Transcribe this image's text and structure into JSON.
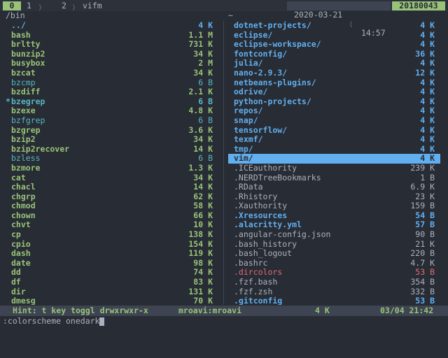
{
  "topbar": {
    "tabs": [
      "0",
      "1",
      "2"
    ],
    "tab2_title": "vifm",
    "date": "2020-03-21",
    "time": "14:57",
    "build": "20180043"
  },
  "left_pane": {
    "path": "/bin",
    "rows": [
      {
        "name": "../",
        "size": "4 K",
        "type": "dir"
      },
      {
        "name": "bash",
        "size": "1.1 M",
        "type": "exe"
      },
      {
        "name": "brltty",
        "size": "731 K",
        "type": "exe"
      },
      {
        "name": "bunzip2",
        "size": "34 K",
        "type": "exe"
      },
      {
        "name": "busybox",
        "size": "2 M",
        "type": "exe"
      },
      {
        "name": "bzcat",
        "size": "34 K",
        "type": "exe"
      },
      {
        "name": "bzcmp",
        "size": "6 B",
        "type": "link"
      },
      {
        "name": "bzdiff",
        "size": "2.1 K",
        "type": "exe"
      },
      {
        "name": "bzegrep",
        "size": "6 B",
        "type": "curlink",
        "marker": "*"
      },
      {
        "name": "bzexe",
        "size": "4.8 K",
        "type": "exe"
      },
      {
        "name": "bzfgrep",
        "size": "6 B",
        "type": "link"
      },
      {
        "name": "bzgrep",
        "size": "3.6 K",
        "type": "exe"
      },
      {
        "name": "bzip2",
        "size": "34 K",
        "type": "exe"
      },
      {
        "name": "bzip2recover",
        "size": "14 K",
        "type": "exe"
      },
      {
        "name": "bzless",
        "size": "6 B",
        "type": "link"
      },
      {
        "name": "bzmore",
        "size": "1.3 K",
        "type": "exe"
      },
      {
        "name": "cat",
        "size": "34 K",
        "type": "exe"
      },
      {
        "name": "chacl",
        "size": "14 K",
        "type": "exe"
      },
      {
        "name": "chgrp",
        "size": "62 K",
        "type": "exe"
      },
      {
        "name": "chmod",
        "size": "58 K",
        "type": "exe"
      },
      {
        "name": "chown",
        "size": "66 K",
        "type": "exe"
      },
      {
        "name": "chvt",
        "size": "10 K",
        "type": "exe"
      },
      {
        "name": "cp",
        "size": "138 K",
        "type": "exe"
      },
      {
        "name": "cpio",
        "size": "154 K",
        "type": "exe"
      },
      {
        "name": "dash",
        "size": "119 K",
        "type": "exe"
      },
      {
        "name": "date",
        "size": "98 K",
        "type": "exe"
      },
      {
        "name": "dd",
        "size": "74 K",
        "type": "exe"
      },
      {
        "name": "df",
        "size": "83 K",
        "type": "exe"
      },
      {
        "name": "dir",
        "size": "131 K",
        "type": "exe"
      },
      {
        "name": "dmesg",
        "size": "70 K",
        "type": "exe"
      }
    ]
  },
  "right_pane": {
    "path": "~",
    "rows": [
      {
        "name": "dotnet-projects/",
        "size": "4 K",
        "type": "dir"
      },
      {
        "name": "eclipse/",
        "size": "4 K",
        "type": "dir"
      },
      {
        "name": "eclipse-workspace/",
        "size": "4 K",
        "type": "dir"
      },
      {
        "name": "fontconfig/",
        "size": "36 K",
        "type": "dir"
      },
      {
        "name": "julia/",
        "size": "4 K",
        "type": "dir"
      },
      {
        "name": "nano-2.9.3/",
        "size": "12 K",
        "type": "dir"
      },
      {
        "name": "netbeans-plugins/",
        "size": "4 K",
        "type": "dir"
      },
      {
        "name": "odrive/",
        "size": "4 K",
        "type": "dir"
      },
      {
        "name": "python-projects/",
        "size": "4 K",
        "type": "dir"
      },
      {
        "name": "repos/",
        "size": "4 K",
        "type": "dir"
      },
      {
        "name": "snap/",
        "size": "4 K",
        "type": "dir"
      },
      {
        "name": "tensorflow/",
        "size": "4 K",
        "type": "dir"
      },
      {
        "name": "texmf/",
        "size": "4 K",
        "type": "dir"
      },
      {
        "name": "tmp/",
        "size": "4 K",
        "type": "dir"
      },
      {
        "name": "vim/",
        "size": "4 K",
        "type": "dir",
        "selected": true
      },
      {
        "name": ".ICEauthority",
        "size": "239 K",
        "type": "file"
      },
      {
        "name": ".NERDTreeBookmarks",
        "size": "1 B",
        "type": "file"
      },
      {
        "name": ".RData",
        "size": "6.9 K",
        "type": "file"
      },
      {
        "name": ".Rhistory",
        "size": "23 K",
        "type": "file"
      },
      {
        "name": ".Xauthority",
        "size": "159 B",
        "type": "file"
      },
      {
        "name": ".Xresources",
        "size": "54 B",
        "type": "hid-dir"
      },
      {
        "name": ".alacritty.yml",
        "size": "57 B",
        "type": "hid-dir"
      },
      {
        "name": ".angular-config.json",
        "size": "90 B",
        "type": "file"
      },
      {
        "name": ".bash_history",
        "size": "21 K",
        "type": "file"
      },
      {
        "name": ".bash_logout",
        "size": "220 B",
        "type": "file"
      },
      {
        "name": ".bashrc",
        "size": "4.7 K",
        "type": "file"
      },
      {
        "name": ".dircolors",
        "size": "53 B",
        "type": "hid-red"
      },
      {
        "name": ".fzf.bash",
        "size": "354 B",
        "type": "file"
      },
      {
        "name": ".fzf.zsh",
        "size": "332 B",
        "type": "file"
      },
      {
        "name": ".gitconfig",
        "size": "53 B",
        "type": "hid-dir"
      }
    ]
  },
  "statusbar": {
    "hint": "Hint: t key toggl drwxrwxr-x",
    "user": "mroavi:mroavi",
    "size": "4 K",
    "pos": "03/04 21:42"
  },
  "cmdline": ":colorscheme onedark",
  "colors": {
    "background": "#282c34",
    "directory": "#61afef",
    "executable": "#98c379",
    "link": "#56b6c2",
    "selection": "#61afef",
    "accent_red": "#e06c75"
  }
}
